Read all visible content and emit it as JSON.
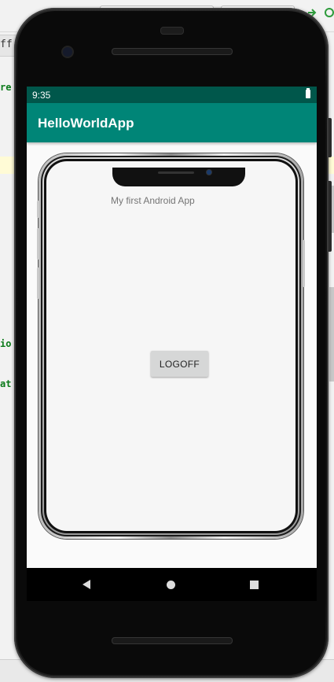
{
  "ide": {
    "tab_label": "ff.ja",
    "code_fragments": [
      "re",
      "io",
      "at"
    ]
  },
  "device": {
    "status_time": "9:35",
    "app_title": "HelloWorldApp",
    "content_text": "My first Android App",
    "logoff_label": "LOGOFF"
  },
  "colors": {
    "status_bar": "#00574b",
    "app_bar": "#008577",
    "button": "#d6d7d7"
  },
  "icons": [
    "battery-icon",
    "back-icon",
    "home-icon",
    "recent-apps-icon",
    "front-camera-icon"
  ]
}
